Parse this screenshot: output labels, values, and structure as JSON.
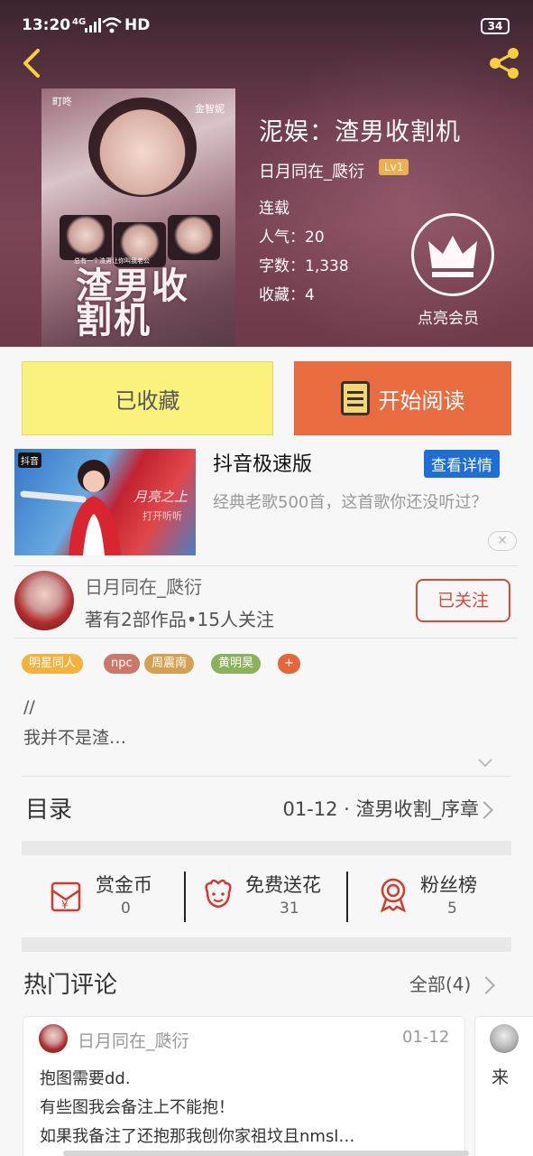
{
  "status_bar": {
    "time": "13:20",
    "network": "4G",
    "hd": "HD",
    "battery": "34"
  },
  "book": {
    "title": "泥娱：渣男收割机",
    "author": "日月同在_瓞衍",
    "level": "Lv1",
    "status": "连载",
    "popularity": "人气：20",
    "word_count": "字数：1,338",
    "favorites": "收藏：4",
    "cover": {
      "name_left": "町咚",
      "name_right": "金智妮",
      "title": "渣男收割机",
      "subtitle": "总有一个渣男让你叫我老公"
    }
  },
  "vip_label": "点亮会员",
  "actions": {
    "favorited": "已收藏",
    "start_reading": "开始阅读"
  },
  "ad": {
    "badge": "抖音",
    "image_text_1": "月亮之上",
    "image_text_2": "打开听听",
    "title": "抖音极速版",
    "detail_button": "查看详情",
    "description": "经典老歌500首，这首歌你还没听过？",
    "close": "✕"
  },
  "author_card": {
    "name": "日月同在_瓞衍",
    "stats": "著有2部作品•15人关注",
    "follow_button": "已关注"
  },
  "tags": [
    {
      "label": "明星同人",
      "color": "#f2b23c"
    },
    {
      "label": "npc",
      "color": "#c9786a"
    },
    {
      "label": "周震南",
      "color": "#d4a052"
    },
    {
      "label": "黄明昊",
      "color": "#8bb15d"
    },
    {
      "label": "+",
      "color": "#e6653a"
    }
  ],
  "intro": {
    "line1": "//",
    "line2": "我并不是渣…"
  },
  "toc": {
    "label": "目录",
    "latest": "01-12 · 渣男收割_序章"
  },
  "stats": [
    {
      "label": "赏金币",
      "value": "0",
      "icon": "coin-envelope-icon"
    },
    {
      "label": "免费送花",
      "value": "31",
      "icon": "flower-icon"
    },
    {
      "label": "粉丝榜",
      "value": "5",
      "icon": "medal-icon"
    }
  ],
  "comments": {
    "label": "热门评论",
    "all": "全部(4)",
    "items": [
      {
        "user": "日月同在_瓞衍",
        "date": "01-12",
        "lines": [
          "抱图需要dd.",
          "有些图我会备注上不能抱！",
          "如果我备注了还抱那我刨你家祖坟且nmsl…"
        ]
      },
      {
        "lines": [
          "来"
        ]
      }
    ]
  },
  "colors": {
    "accent": "#e96b40",
    "fav_yellow": "#fbf27d",
    "follow_red": "#d9493a",
    "ad_blue": "#1e6ed6"
  }
}
